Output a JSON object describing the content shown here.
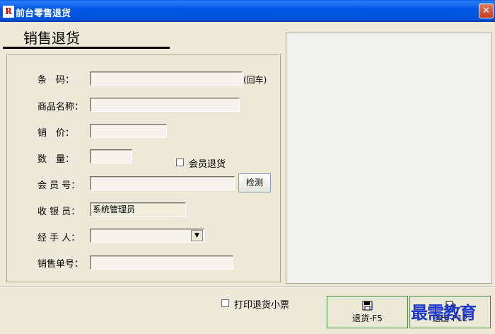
{
  "window": {
    "title": "前台零售退货",
    "app_icon_glyph": "R",
    "close_glyph": "✕"
  },
  "heading": "销售退货",
  "form": {
    "barcode_label": "条　码：",
    "barcode_value": "",
    "barcode_suffix": "(回车)",
    "product_name_label": "商品名称：",
    "product_name_value": "",
    "price_label": "销　价：",
    "price_value": "",
    "quantity_label": "数　量：",
    "quantity_value": "",
    "member_return_label": "会员退货",
    "member_return_checked": false,
    "member_no_label": "会 员 号：",
    "member_no_value": "",
    "check_button": "检测",
    "cashier_label": "收 银 员：",
    "cashier_value": "系统管理员",
    "handler_label": "经 手 人：",
    "handler_value": "",
    "sale_no_label": "销售单号：",
    "sale_no_value": ""
  },
  "footer": {
    "print_receipt_label": "打印退货小票",
    "print_receipt_checked": false,
    "return_button": "退货-F5",
    "exit_button": "退出-F12"
  },
  "watermark": "最需教育",
  "icons": {
    "return": "save-icon",
    "exit": "exit-icon",
    "dropdown": "chevron-down-icon"
  },
  "colors": {
    "titlebar": "#0058e6",
    "accent_border": "#3c8f3c",
    "watermark": "#1d39c8"
  }
}
